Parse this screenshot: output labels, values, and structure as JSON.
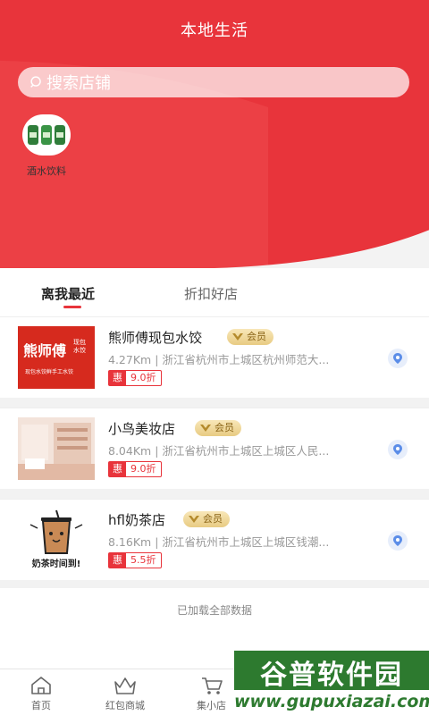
{
  "header": {
    "title": "本地生活"
  },
  "search": {
    "placeholder": "搜索店铺",
    "icon": "search-icon"
  },
  "categories": [
    {
      "label": "酒水饮料"
    }
  ],
  "tabs": [
    {
      "label": "离我最近",
      "active": true
    },
    {
      "label": "折扣好店",
      "active": false
    }
  ],
  "stores": [
    {
      "name": "熊师傅现包水饺",
      "member_badge": "会员",
      "distance": "4.27Km",
      "address": "浙江省杭州市上城区杭州师范大...",
      "discount_label": "惠",
      "discount": "9.0折",
      "logo_text": "熊师傅",
      "logo_sub": "现包水饺",
      "logo_note": "现包水饺鲜手工水饺"
    },
    {
      "name": "小鸟美妆店",
      "member_badge": "会员",
      "distance": "8.04Km",
      "address": "浙江省杭州市上城区上城区人民...",
      "discount_label": "惠",
      "discount": "9.0折"
    },
    {
      "name": "hfl奶茶店",
      "member_badge": "会员",
      "distance": "8.16Km",
      "address": "浙江省杭州市上城区上城区钱潮...",
      "discount_label": "惠",
      "discount": "5.5折",
      "logo_text": "奶茶时间到!"
    }
  ],
  "footer_status": "已加载全部数据",
  "tabbar": [
    {
      "label": "首页",
      "icon": "home-icon"
    },
    {
      "label": "红包商城",
      "icon": "crown-icon"
    },
    {
      "label": "集小店",
      "icon": "cart-icon"
    }
  ],
  "watermark": {
    "title": "谷普软件园",
    "url": "www.gupuxiazai.com"
  },
  "colors": {
    "brand_red": "#e8343b",
    "watermark_green": "#2d7a2f",
    "vip_gold": "#e8cb82"
  }
}
